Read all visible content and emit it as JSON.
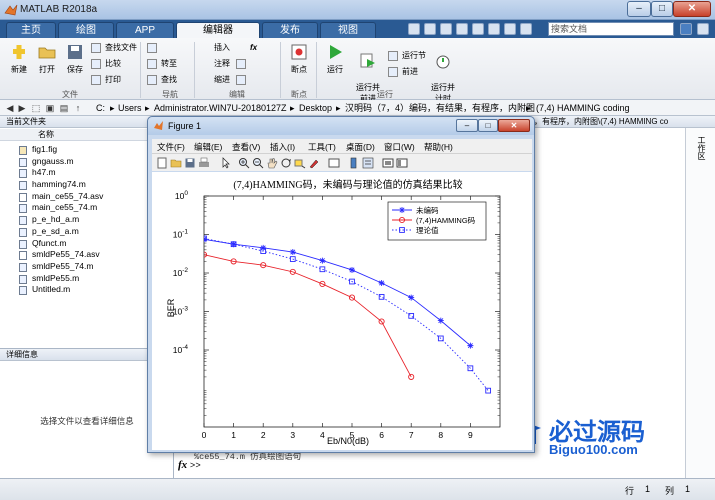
{
  "window": {
    "title": "MATLAB R2018a",
    "min": "–",
    "max": "□",
    "close": "✕"
  },
  "tabs": [
    "主页",
    "绘图",
    "APP",
    "编辑器",
    "发布",
    "视图"
  ],
  "search": {
    "placeholder": "搜索文档"
  },
  "ribbon": {
    "new": "新建",
    "open": "打开",
    "save": "保存",
    "find_files": "查找文件",
    "compare": "比较",
    "print": "打印",
    "goto": "转至",
    "find": "查找",
    "insert": "插入",
    "comment": "注释",
    "indent": "缩进",
    "fx": "fx",
    "breakpoints": "断点",
    "run": "运行",
    "run_advance": "运行并\n前进",
    "run_section": "运行节",
    "advance": "前进",
    "run_time": "运行并\n计时",
    "groups": {
      "file": "文件",
      "navigate": "导航",
      "edit": "编辑",
      "breakpoints": "断点",
      "run": "运行"
    }
  },
  "address": {
    "path": [
      "C:",
      "Users",
      "Administrator.WIN7U-20180127Z",
      "Desktop",
      "汉明码（7，4）编码，有结果，有程序，内附图",
      "(7,4) HAMMING coding"
    ]
  },
  "folder_panel": {
    "title": "当前文件夹",
    "column": "名称",
    "files": [
      {
        "name": "fig1.fig",
        "kind": "fig"
      },
      {
        "name": "gngauss.m",
        "kind": "m"
      },
      {
        "name": "h47.m",
        "kind": "m"
      },
      {
        "name": "hamming74.m",
        "kind": "m"
      },
      {
        "name": "main_ce55_74.asv",
        "kind": "asv"
      },
      {
        "name": "main_ce55_74.m",
        "kind": "m"
      },
      {
        "name": "p_e_hd_a.m",
        "kind": "m"
      },
      {
        "name": "p_e_sd_a.m",
        "kind": "m"
      },
      {
        "name": "Qfunct.m",
        "kind": "m"
      },
      {
        "name": "smldPe55_74.asv",
        "kind": "asv"
      },
      {
        "name": "smldPe55_74.m",
        "kind": "m"
      },
      {
        "name": "smldPe55.m",
        "kind": "m"
      },
      {
        "name": "Untitled.m",
        "kind": "m"
      }
    ]
  },
  "detail_panel": {
    "title": "详细信息",
    "message": "选择文件以查看详细信息"
  },
  "command_window": {
    "header_path": "，有程序，内附图\\(7,4) HAMMING co",
    "workspace_label": "工作区",
    "line": "%ce55_74.m 仿真绘图语句",
    "prompt": ">>"
  },
  "statusbar": {
    "line_label": "行",
    "line_value": "1",
    "col_label": "列",
    "col_value": "1"
  },
  "watermark": {
    "brand": "必过源码",
    "url": "Biguo100.com"
  },
  "figure": {
    "title": "Figure 1",
    "menu": [
      "文件(F)",
      "编辑(E)",
      "查看(V)",
      "插入(I)",
      "工具(T)",
      "桌面(D)",
      "窗口(W)",
      "帮助(H)"
    ]
  },
  "chart_data": {
    "type": "line",
    "title": "(7,4)HAMMING码，未编码与理论值的仿真结果比较",
    "xlabel": "Eb/N0(dB)",
    "ylabel": "BER",
    "xlim": [
      0,
      10
    ],
    "ylim": [
      1e-06,
      1
    ],
    "yscale": "log",
    "xticks": [
      0,
      1,
      2,
      3,
      4,
      5,
      6,
      7,
      8,
      9
    ],
    "yticks": [
      "10^0",
      "10^-1",
      "10^-2",
      "10^-3",
      "10^-4"
    ],
    "legend_position": "top-right",
    "series": [
      {
        "name": "未编码",
        "color": "#2a2aff",
        "marker": "star",
        "style": "solid",
        "x": [
          0,
          1,
          2,
          3,
          4,
          5,
          6,
          7,
          8,
          9
        ],
        "y": [
          0.075,
          0.056,
          0.045,
          0.035,
          0.021,
          0.012,
          0.0055,
          0.0023,
          0.00058,
          0.00013
        ]
      },
      {
        "name": "(7,4)HAMMING码",
        "color": "#e8222a",
        "marker": "circle",
        "style": "solid",
        "x": [
          0,
          1,
          2,
          3,
          4,
          5,
          6,
          7
        ],
        "y": [
          0.03,
          0.02,
          0.016,
          0.0107,
          0.0052,
          0.0023,
          0.00055,
          2e-05
        ]
      },
      {
        "name": "理论值",
        "color": "#2a2aff",
        "marker": "square",
        "style": "dotted",
        "x": [
          0,
          1,
          2,
          3,
          4,
          5,
          6,
          7,
          8,
          9,
          9.6
        ],
        "y": [
          0.079,
          0.056,
          0.037,
          0.023,
          0.0125,
          0.006,
          0.0024,
          0.00077,
          0.0002,
          3.35e-05,
          8.8e-06
        ]
      }
    ]
  }
}
